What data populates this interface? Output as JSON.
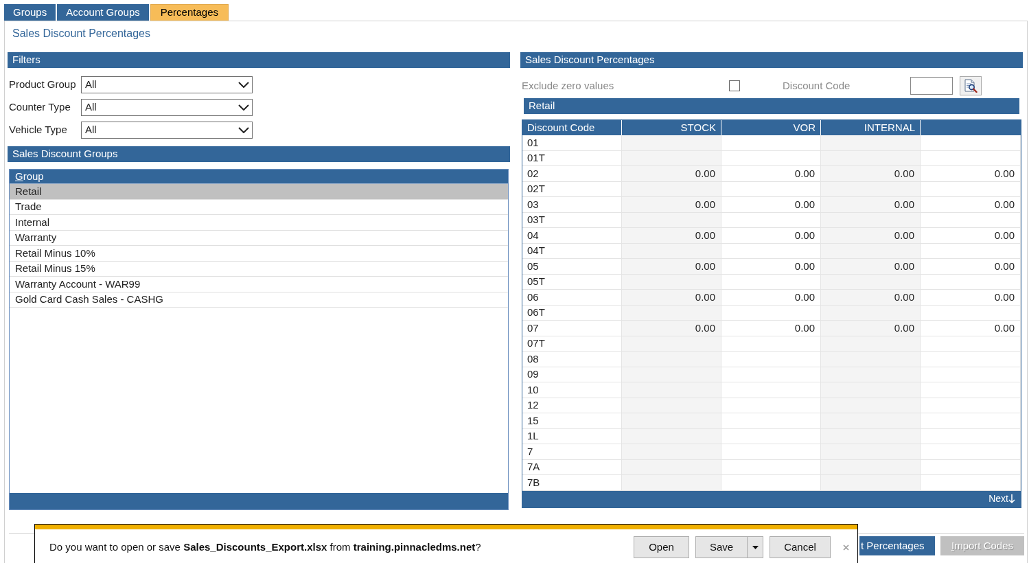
{
  "tabs": [
    {
      "label": "Groups",
      "selected": false
    },
    {
      "label": "Account Groups",
      "selected": false
    },
    {
      "label": "Percentages",
      "selected": true
    }
  ],
  "page_title": "Sales Discount Percentages",
  "filters": {
    "title": "Filters",
    "fields": [
      {
        "label": "Product Group",
        "value": "All"
      },
      {
        "label": "Counter Type",
        "value": "All"
      },
      {
        "label": "Vehicle Type",
        "value": "All"
      }
    ]
  },
  "groups": {
    "title": "Sales Discount Groups",
    "column": {
      "label": "Group",
      "mnemonic": true
    },
    "items": [
      {
        "label": "Retail",
        "selected": true
      },
      {
        "label": "Trade",
        "selected": false
      },
      {
        "label": "Internal",
        "selected": false
      },
      {
        "label": "Warranty",
        "selected": false
      },
      {
        "label": "Retail Minus 10%",
        "selected": false
      },
      {
        "label": "Retail Minus 15%",
        "selected": false
      },
      {
        "label": "Warranty Account - WAR99",
        "selected": false
      },
      {
        "label": "Gold Card Cash Sales - CASHG",
        "selected": false
      }
    ]
  },
  "percentages": {
    "title": "Sales Discount Percentages",
    "exclude_zero": {
      "label": "Exclude zero values",
      "checked": false
    },
    "discount_code": {
      "label": "Discount Code"
    },
    "group_title": "Retail",
    "columns": [
      "Discount Code",
      "STOCK",
      "VOR",
      "INTERNAL"
    ],
    "rows": [
      {
        "code": "01"
      },
      {
        "code": "01T"
      },
      {
        "code": "02",
        "values": [
          "0.00",
          "0.00",
          "0.00",
          "0.00"
        ]
      },
      {
        "code": "02T"
      },
      {
        "code": "03",
        "values": [
          "0.00",
          "0.00",
          "0.00",
          "0.00"
        ]
      },
      {
        "code": "03T"
      },
      {
        "code": "04",
        "values": [
          "0.00",
          "0.00",
          "0.00",
          "0.00"
        ]
      },
      {
        "code": "04T"
      },
      {
        "code": "05",
        "values": [
          "0.00",
          "0.00",
          "0.00",
          "0.00"
        ]
      },
      {
        "code": "05T"
      },
      {
        "code": "06",
        "values": [
          "0.00",
          "0.00",
          "0.00",
          "0.00"
        ]
      },
      {
        "code": "06T"
      },
      {
        "code": "07",
        "values": [
          "0.00",
          "0.00",
          "0.00",
          "0.00"
        ]
      },
      {
        "code": "07T"
      },
      {
        "code": "08"
      },
      {
        "code": "09"
      },
      {
        "code": "10"
      },
      {
        "code": "12"
      },
      {
        "code": "15"
      },
      {
        "code": "1L"
      },
      {
        "code": "7"
      },
      {
        "code": "7A"
      },
      {
        "code": "7B"
      }
    ],
    "next": "Next"
  },
  "footer_buttons": [
    {
      "label": "t Percentages",
      "disabled": false,
      "mnemonic": false
    },
    {
      "label": "Import Codes",
      "disabled": true,
      "mnemonic": true
    }
  ],
  "download_bar": {
    "message": "Do you want to open or save **Sales_Discounts_Export.xlsx** from **training.pinnacledms.net**?",
    "buttons": [
      {
        "label": "Open",
        "kind": "plain"
      },
      {
        "label": "Save",
        "kind": "split"
      },
      {
        "label": "Cancel",
        "kind": "plain"
      }
    ]
  }
}
